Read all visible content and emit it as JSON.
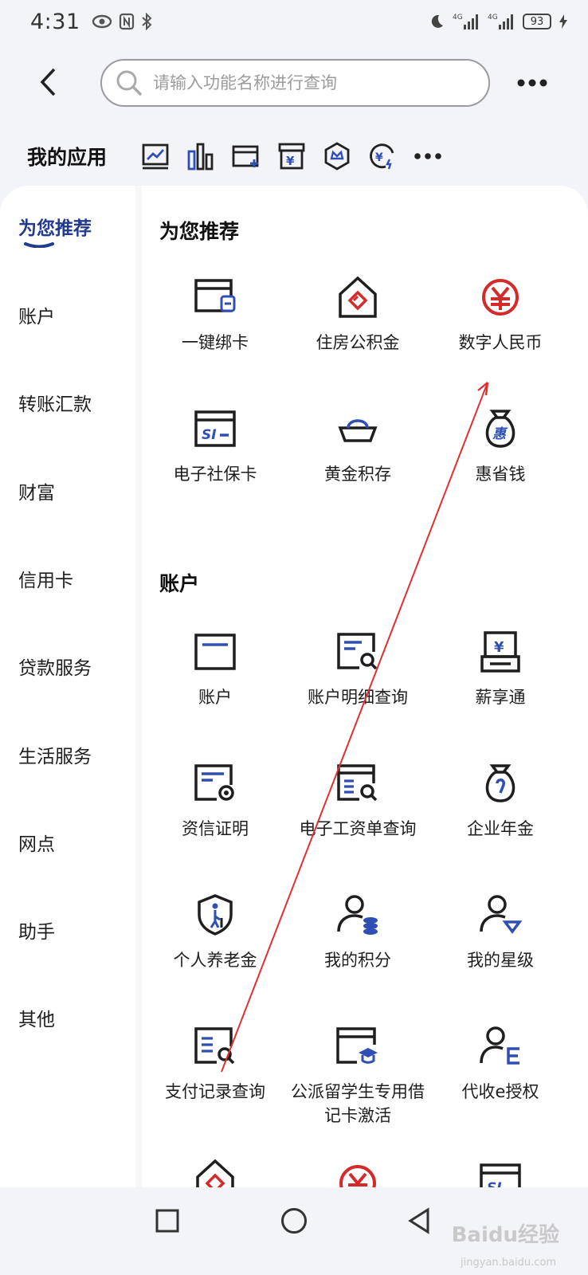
{
  "status_bar": {
    "time": "4:31",
    "battery": "93"
  },
  "header": {
    "search_placeholder": "请输入功能名称进行查询"
  },
  "my_apps": {
    "title": "我的应用"
  },
  "sidebar": {
    "items": [
      {
        "label": "为您推荐"
      },
      {
        "label": "账户"
      },
      {
        "label": "转账汇款"
      },
      {
        "label": "财富"
      },
      {
        "label": "信用卡"
      },
      {
        "label": "贷款服务"
      },
      {
        "label": "生活服务"
      },
      {
        "label": "网点"
      },
      {
        "label": "助手"
      },
      {
        "label": "其他"
      }
    ]
  },
  "sections": {
    "recommended": {
      "title": "为您推荐",
      "tiles": [
        {
          "label": "一键绑卡",
          "icon": "bind-card-icon"
        },
        {
          "label": "住房公积金",
          "icon": "housing-fund-icon"
        },
        {
          "label": "数字人民币",
          "icon": "digital-rmb-icon"
        },
        {
          "label": "电子社保卡",
          "icon": "social-security-card-icon"
        },
        {
          "label": "黄金积存",
          "icon": "gold-ingot-icon"
        },
        {
          "label": "惠省钱",
          "icon": "money-bag-icon"
        }
      ]
    },
    "account": {
      "title": "账户",
      "tiles": [
        {
          "label": "账户",
          "icon": "account-card-icon"
        },
        {
          "label": "账户明细查询",
          "icon": "account-detail-search-icon"
        },
        {
          "label": "薪享通",
          "icon": "salary-icon"
        },
        {
          "label": "资信证明",
          "icon": "credit-certificate-icon"
        },
        {
          "label": "电子工资单查询",
          "icon": "payslip-search-icon"
        },
        {
          "label": "企业年金",
          "icon": "annuity-bag-icon"
        },
        {
          "label": "个人养老金",
          "icon": "pension-shield-icon"
        },
        {
          "label": "我的积分",
          "icon": "user-points-icon"
        },
        {
          "label": "我的星级",
          "icon": "user-star-level-icon"
        },
        {
          "label": "支付记录查询",
          "icon": "payment-record-search-icon"
        },
        {
          "label": "公派留学生专用借记卡激活",
          "icon": "study-abroad-card-icon"
        },
        {
          "label": "代收e授权",
          "icon": "user-e-authorization-icon"
        }
      ]
    }
  },
  "watermark": {
    "text": "Baidu经验",
    "sub": "jingyan.baidu.com"
  },
  "colors": {
    "accent": "#233b8f",
    "red": "#d42a2a",
    "blue": "#2f4fb5"
  }
}
